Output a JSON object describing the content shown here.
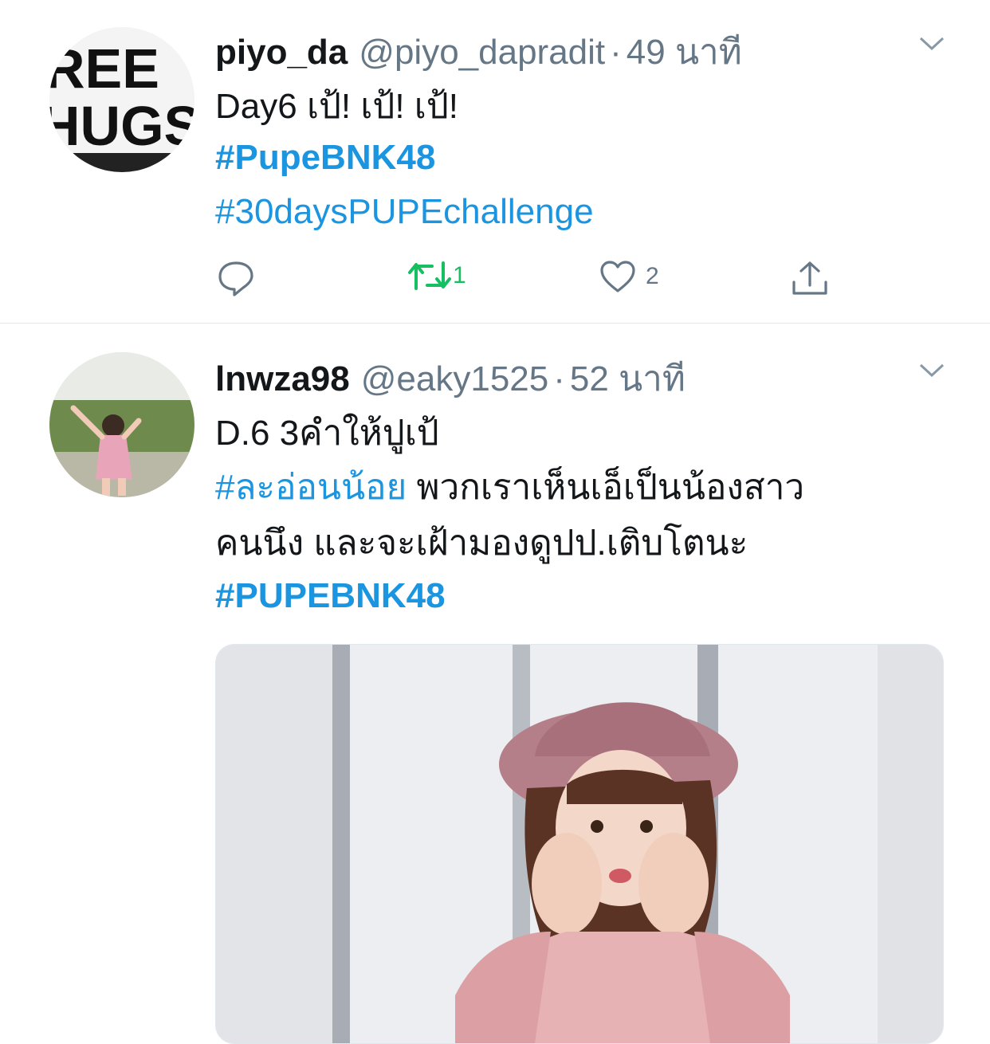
{
  "tweets": [
    {
      "display_name": "piyo_da",
      "handle": "@piyo_dapradit",
      "separator": "·",
      "time": "49 นาที",
      "avatar_text_top": "REE",
      "avatar_text_bottom": "HUGS",
      "lines": [
        "Day6 เป้! เป้! เป้!"
      ],
      "hashtags": [
        "#PupeBNK48",
        "#30daysPUPEchallenge"
      ],
      "actions": {
        "reply_count": "",
        "retweet_count": "1",
        "like_count": "2"
      }
    },
    {
      "display_name": "lnwza98",
      "handle": "@eaky1525",
      "separator": "·",
      "time": "52 นาที",
      "line1": "D.6  3คำให้ปูเป้",
      "line2_hashtag": "#ละอ่อนน้อย",
      "line2_text": " พวกเราเห็นเอ็เป็นน้องสาว",
      "line3": "คนนึง และจะเฝ้ามองดูปป.เติบโตนะ",
      "line4_hashtag": "#PUPEBNK48"
    }
  ],
  "colors": {
    "link": "#1b95e0",
    "muted": "#657786",
    "retweet_active": "#17bf63",
    "divider": "#e1e8ed"
  },
  "icons": {
    "reply": "comment-bubble-icon",
    "retweet": "retweet-arrows-icon",
    "like": "heart-outline-icon",
    "share": "share-upload-icon",
    "menu": "chevron-down-icon"
  }
}
